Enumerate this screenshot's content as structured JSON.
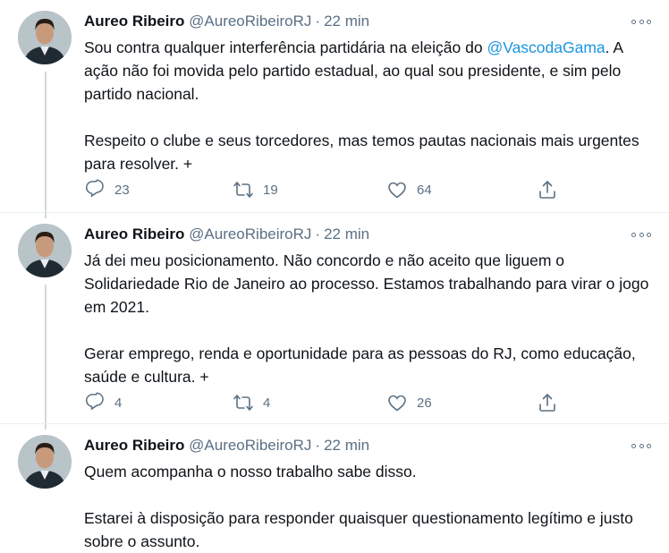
{
  "colors": {
    "link": "#1b95e0",
    "muted": "#5b7083",
    "text": "#0f1419",
    "thread_line": "#cfd9de"
  },
  "tweets": [
    {
      "author": {
        "name": "Aureo Ribeiro",
        "handle": "@AureoRibeiroRJ",
        "separator": "·",
        "time": "22 min"
      },
      "paragraphs": [
        {
          "pre": "Sou contra qualquer interferência partidária na eleição do ",
          "mention": "@VascodaGama",
          "post": ". A ação não foi movida pelo partido estadual, ao qual sou presidente, e sim pelo partido nacional."
        },
        {
          "pre": "Respeito o clube e seus torcedores, mas temos pautas nacionais mais urgentes para resolver. +"
        }
      ],
      "stats": {
        "replies": "23",
        "retweets": "19",
        "likes": "64"
      }
    },
    {
      "author": {
        "name": "Aureo Ribeiro",
        "handle": "@AureoRibeiroRJ",
        "separator": "·",
        "time": "22 min"
      },
      "paragraphs": [
        {
          "pre": "Já dei meu posicionamento. Não concordo e não aceito que liguem o Solidariedade Rio de Janeiro ao processo. Estamos trabalhando para virar o jogo em 2021."
        },
        {
          "pre": "Gerar emprego, renda e oportunidade para as pessoas do RJ, como educação, saúde e cultura. +"
        }
      ],
      "stats": {
        "replies": "4",
        "retweets": "4",
        "likes": "26"
      }
    },
    {
      "author": {
        "name": "Aureo Ribeiro",
        "handle": "@AureoRibeiroRJ",
        "separator": "·",
        "time": "22 min"
      },
      "paragraphs": [
        {
          "pre": "Quem acompanha o nosso trabalho sabe disso."
        },
        {
          "pre": "Estarei à disposição para responder quaisquer questionamento legítimo e justo sobre o assunto."
        }
      ]
    }
  ],
  "icons": {
    "reply": "reply-icon",
    "retweet": "retweet-icon",
    "like": "heart-icon",
    "share": "share-icon",
    "more": "more-options-icon"
  }
}
